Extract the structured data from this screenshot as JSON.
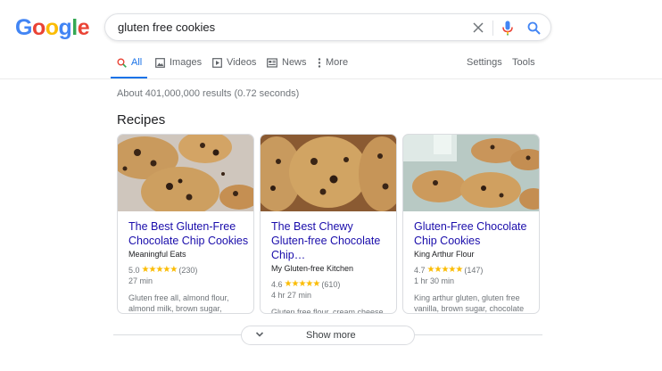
{
  "logo": {
    "letters": [
      "G",
      "o",
      "o",
      "g",
      "l",
      "e"
    ],
    "colors": [
      "#4285f4",
      "#ea4335",
      "#fbbc05",
      "#4285f4",
      "#34a853",
      "#ea4335"
    ]
  },
  "search": {
    "query": "gluten free cookies",
    "clear_icon": "close-icon",
    "voice_icon": "microphone-icon",
    "search_icon": "search-icon"
  },
  "tabs": [
    {
      "label": "All",
      "icon": "search-icon",
      "active": true
    },
    {
      "label": "Images",
      "icon": "image-icon"
    },
    {
      "label": "Videos",
      "icon": "play-icon"
    },
    {
      "label": "News",
      "icon": "newspaper-icon"
    },
    {
      "label": "More",
      "icon": "more-vert-icon"
    }
  ],
  "tools": {
    "settings_label": "Settings",
    "tools_label": "Tools"
  },
  "result_stats": "About 401,000,000 results (0.72 seconds)",
  "recipes": {
    "title": "Recipes",
    "cards": [
      {
        "title": "The Best Gluten-Free Chocolate Chip Cookies",
        "source": "Meaningful Eats",
        "rating": "5.0",
        "stars": 5,
        "reviews": "(230)",
        "time": "27 min",
        "ingredients": "Gluten free all, almond flour, almond milk, brown sugar,"
      },
      {
        "title": "The Best Chewy Gluten-free Chocolate Chip…",
        "source": "My Gluten-free Kitchen",
        "rating": "4.6",
        "stars": 4.5,
        "reviews": "(610)",
        "time": "4 hr 27 min",
        "ingredients": "Gluten free flour, cream cheese, brown sugar, sweet chocolate"
      },
      {
        "title": "Gluten-Free Chocolate Chip Cookies",
        "source": "King Arthur Flour",
        "rating": "4.7",
        "stars": 4.5,
        "reviews": "(147)",
        "time": "1 hr 30 min",
        "ingredients": "King arthur gluten, gluten free vanilla, brown sugar, chocolate"
      }
    ]
  },
  "show_more": {
    "label": "Show more",
    "icon": "chevron-down-icon"
  }
}
